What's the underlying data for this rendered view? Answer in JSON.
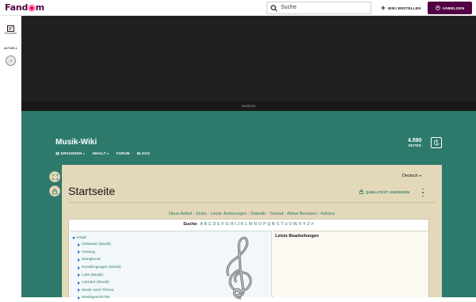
{
  "topbar": {
    "logo_text_a": "Fand",
    "logo_text_b": "m",
    "search_placeholder": "Suche",
    "create_label": "WIKI ERSTELLEN",
    "login_label": "ANMELDEN"
  },
  "leftrail": {
    "explore_label": "Erkunden",
    "section_label": "AKTUELL"
  },
  "ad": {
    "label": "ANZEIGE"
  },
  "wiki": {
    "title": "Musik-Wiki",
    "nav": [
      {
        "label": "ERKUNDEN"
      },
      {
        "label": "INHALT"
      },
      {
        "label": "FORUM"
      },
      {
        "label": "BLOGS"
      }
    ],
    "page_count": "4.590",
    "page_count_label": "SEITEN"
  },
  "page": {
    "language": "Deutsch",
    "title": "Startseite",
    "edit_label": "QUELLTEXT ANZEIGEN",
    "links": [
      "Neue Artikel",
      "Stubs",
      "Letzte Änderungen",
      "Statistik",
      "Tutorial",
      "Aktive Benutzer",
      "Admins"
    ],
    "search_label": "Suche:",
    "letters": [
      "A",
      "B",
      "C",
      "D",
      "E",
      "F",
      "G",
      "H",
      "I",
      "J",
      "K",
      "L",
      "M",
      "N",
      "O",
      "P",
      "Q",
      "R",
      "S",
      "T",
      "U",
      "V",
      "W",
      "X",
      "Y",
      "Z",
      "#"
    ],
    "tree_root": "Inhalt",
    "tree_items": [
      "Gebäude (Musik)",
      "Gesang",
      "Klangkunst",
      "Künstlergruppe (Musik)",
      "Liste (Musik)",
      "Literatur (Musik)",
      "Musik nach Thema",
      "Musikgeschichte"
    ],
    "recent_edits_title": "Letzte Bearbeitungen"
  },
  "colors": {
    "brand": "#520044",
    "accent": "#fa005a",
    "community_bg": "#2d7a6c",
    "card_bg": "#e3d8b9",
    "link": "#2d7a6c"
  }
}
